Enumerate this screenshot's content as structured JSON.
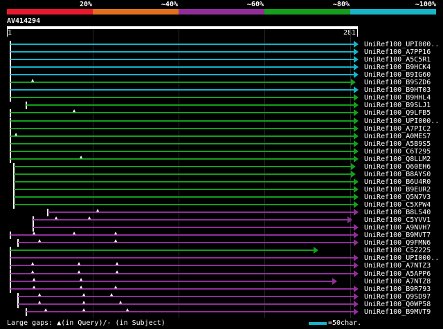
{
  "legend": [
    {
      "label": "20%",
      "color": "#e8192c"
    },
    {
      "label": "~40%",
      "color": "#e0701c"
    },
    {
      "label": "~60%",
      "color": "#922e9a"
    },
    {
      "label": "~80%",
      "color": "#14a01c"
    },
    {
      "label": "~100%",
      "color": "#18b4c8"
    }
  ],
  "query": {
    "label": "AV414294",
    "start": "1",
    "end": "281"
  },
  "hits": [
    {
      "label": "UniRef100_UPI000..",
      "color": "cyan",
      "gaps": []
    },
    {
      "label": "UniRef100_A7PP16",
      "color": "cyan",
      "gaps": []
    },
    {
      "label": "UniRef100_A5C5R1",
      "color": "cyan",
      "gaps": []
    },
    {
      "label": "UniRef100_B9HCK4",
      "color": "cyan",
      "gaps": []
    },
    {
      "label": "UniRef100_B9IG60",
      "color": "cyan",
      "gaps": []
    },
    {
      "label": "UniRef100_B9SZD6",
      "color": "green",
      "gaps": []
    },
    {
      "label": "UniRef100_B9HT03",
      "color": "cyan",
      "gaps": []
    },
    {
      "label": "UniRef100_B9HHL4",
      "color": "green",
      "gaps": []
    },
    {
      "label": "UniRef100_B9SLJ1",
      "color": "green",
      "gaps": []
    },
    {
      "label": "UniRef100_Q9LFB5",
      "color": "green",
      "gaps": []
    },
    {
      "label": "UniRef100_UPI000..",
      "color": "green",
      "gaps": []
    },
    {
      "label": "UniRef100_A7PIC2",
      "color": "green",
      "gaps": []
    },
    {
      "label": "UniRef100_A0MES7",
      "color": "green",
      "gaps": []
    },
    {
      "label": "UniRef100_A5B9S5",
      "color": "green",
      "gaps": []
    },
    {
      "label": "UniRef100_C6T295",
      "color": "green",
      "gaps": []
    },
    {
      "label": "UniRef100_Q8LLM2",
      "color": "green",
      "gaps": []
    },
    {
      "label": "UniRef100_Q60EH6",
      "color": "green",
      "gaps": []
    },
    {
      "label": "UniRef100_B8AYS0",
      "color": "green",
      "gaps": []
    },
    {
      "label": "UniRef100_B6U4R0",
      "color": "green",
      "gaps": []
    },
    {
      "label": "UniRef100_B9EUR2",
      "color": "green",
      "gaps": []
    },
    {
      "label": "UniRef100_Q5N7V3",
      "color": "green",
      "gaps": []
    },
    {
      "label": "UniRef100_C5XPW4",
      "color": "green",
      "gaps": []
    },
    {
      "label": "UniRef100_B8LS40",
      "color": "purple",
      "gaps": []
    },
    {
      "label": "UniRef100_C5YVV1",
      "color": "purple",
      "gaps": []
    },
    {
      "label": "UniRef100_A9NVH7",
      "color": "purple",
      "gaps": []
    },
    {
      "label": "UniRef100_B9MVT7",
      "color": "purple",
      "gaps": []
    },
    {
      "label": "UniRef100_Q9FMN6",
      "color": "purple",
      "gaps": []
    },
    {
      "label": "UniRef100_C5Z225",
      "color": "green",
      "gaps": []
    },
    {
      "label": "UniRef100_UPI000..",
      "color": "purple",
      "gaps": []
    },
    {
      "label": "UniRef100_A7NTZ3",
      "color": "purple",
      "gaps": []
    },
    {
      "label": "UniRef100_A5APP6",
      "color": "purple",
      "gaps": []
    },
    {
      "label": "UniRef100_A7NTZ8",
      "color": "purple",
      "gaps": []
    },
    {
      "label": "UniRef100_B9R793",
      "color": "purple",
      "gaps": []
    },
    {
      "label": "UniRef100_Q9SD97",
      "color": "purple",
      "gaps": []
    },
    {
      "label": "UniRef100_Q0WP58",
      "color": "purple",
      "gaps": []
    },
    {
      "label": "UniRef100_B9MVT9",
      "color": "purple",
      "gaps": []
    }
  ],
  "footer": {
    "gaps_text": "Large gaps: ▲(in Query)/- (in Subject)",
    "scale_text": "=50char."
  },
  "colors": {
    "cyan": "#18b4c8",
    "green": "#14a01c",
    "purple": "#922e9a",
    "grid": "#2a2a2a"
  }
}
